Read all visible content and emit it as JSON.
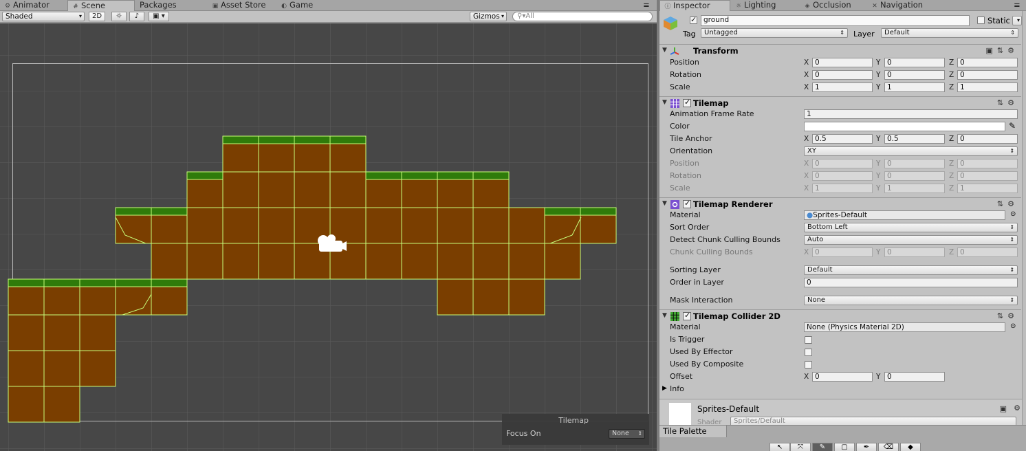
{
  "tabs": [
    {
      "icon": "animator-icon",
      "label": "Animator"
    },
    {
      "icon": "scene-icon",
      "label": "Scene"
    },
    {
      "icon": "",
      "label": "Packages"
    },
    {
      "icon": "asset-store-icon",
      "label": "Asset Store"
    },
    {
      "icon": "game-icon",
      "label": "Game"
    }
  ],
  "scene_toolbar": {
    "draw_mode": "Shaded",
    "mode_2d": "2D",
    "gizmos": "Gizmos",
    "search_placeholder": "All"
  },
  "tilemap_tiles": {
    "rows": [
      {
        "grass": false,
        "cols": []
      }
    ],
    "grid": [
      [
        6,
        7,
        8,
        9
      ],
      [
        5,
        6,
        7,
        8,
        9,
        10,
        11,
        12,
        13
      ],
      [
        3,
        4,
        5,
        6,
        7,
        8,
        9,
        10,
        11,
        12,
        13,
        14,
        15,
        16
      ],
      [
        4,
        5,
        6,
        7,
        8,
        9,
        10,
        11,
        12,
        13,
        14,
        15
      ],
      [
        0,
        1,
        2,
        3,
        4,
        12,
        13,
        14
      ],
      [
        0,
        1,
        2
      ],
      [
        0,
        1,
        2
      ],
      [
        0,
        1
      ]
    ],
    "grass_rows": {
      "0": [
        6,
        7,
        8,
        9
      ],
      "1": [
        5,
        10,
        11,
        12,
        13
      ],
      "2": [
        3,
        4,
        15,
        16
      ],
      "4": [
        0,
        1,
        2,
        3,
        4
      ]
    }
  },
  "focus_panel": {
    "title": "Tilemap",
    "label": "Focus On",
    "value": "None"
  },
  "inspector_tabs": [
    {
      "icon": "info-icon",
      "label": "Inspector"
    },
    {
      "icon": "lighting-icon",
      "label": "Lighting"
    },
    {
      "icon": "occlusion-icon",
      "label": "Occlusion"
    },
    {
      "icon": "navigation-icon",
      "label": "Navigation"
    }
  ],
  "object": {
    "name": "ground",
    "static_label": "Static",
    "tag_label": "Tag",
    "tag": "Untagged",
    "layer_label": "Layer",
    "layer": "Default"
  },
  "transform": {
    "name": "Transform",
    "position": {
      "label": "Position",
      "x": "0",
      "y": "0",
      "z": "0"
    },
    "rotation": {
      "label": "Rotation",
      "x": "0",
      "y": "0",
      "z": "0"
    },
    "scale": {
      "label": "Scale",
      "x": "1",
      "y": "1",
      "z": "1"
    }
  },
  "tilemap": {
    "name": "Tilemap",
    "frame_rate_label": "Animation Frame Rate",
    "frame_rate": "1",
    "color_label": "Color",
    "anchor_label": "Tile Anchor",
    "anchor": {
      "x": "0.5",
      "y": "0.5",
      "z": "0"
    },
    "orientation_label": "Orientation",
    "orientation": "XY",
    "position": {
      "label": "Position",
      "x": "0",
      "y": "0",
      "z": "0"
    },
    "rotation": {
      "label": "Rotation",
      "x": "0",
      "y": "0",
      "z": "0"
    },
    "scale": {
      "label": "Scale",
      "x": "1",
      "y": "1",
      "z": "1"
    }
  },
  "renderer": {
    "name": "Tilemap Renderer",
    "material_label": "Material",
    "material": "Sprites-Default",
    "sort_order_label": "Sort Order",
    "sort_order": "Bottom Left",
    "detect_label": "Detect Chunk Culling Bounds",
    "detect": "Auto",
    "bounds_label": "Chunk Culling Bounds",
    "bounds": {
      "x": "0",
      "y": "0",
      "z": "0"
    },
    "sorting_layer_label": "Sorting Layer",
    "sorting_layer": "Default",
    "order_label": "Order in Layer",
    "order": "0",
    "mask_label": "Mask Interaction",
    "mask": "None"
  },
  "collider": {
    "name": "Tilemap Collider 2D",
    "material_label": "Material",
    "material": "None (Physics Material 2D)",
    "trigger_label": "Is Trigger",
    "effector_label": "Used By Effector",
    "composite_label": "Used By Composite",
    "offset_label": "Offset",
    "offset": {
      "x": "0",
      "y": "0"
    },
    "info_label": "Info"
  },
  "material_preview": {
    "name": "Sprites-Default",
    "shader_label": "Shader",
    "shader": "Sprites/Default"
  },
  "tile_palette": {
    "tab": "Tile Palette"
  },
  "axis": {
    "x": "X",
    "y": "Y",
    "z": "Z"
  },
  "colors": {
    "dirt": "#7a3e00",
    "grass": "#2f7b0a",
    "outline": "#c8ff7a",
    "scene_bg": "#474747"
  }
}
